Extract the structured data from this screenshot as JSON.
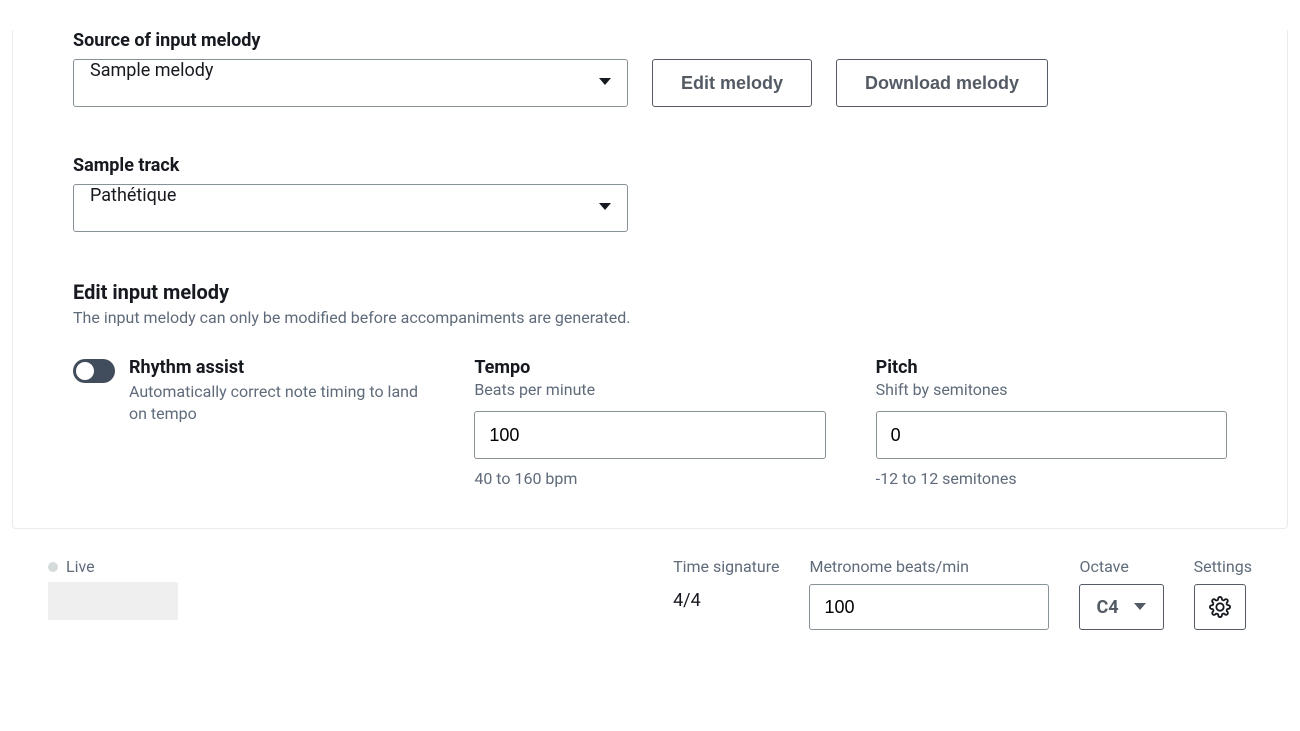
{
  "source": {
    "label": "Source of input melody",
    "value": "Sample melody",
    "edit_btn": "Edit melody",
    "download_btn": "Download melody"
  },
  "sample_track": {
    "label": "Sample track",
    "value": "Pathétique"
  },
  "edit_section": {
    "title": "Edit input melody",
    "desc": "The input melody can only be modified before accompaniments are generated."
  },
  "rhythm": {
    "label": "Rhythm assist",
    "desc": "Automatically correct note timing to land on tempo"
  },
  "tempo": {
    "label": "Tempo",
    "sub": "Beats per minute",
    "value": "100",
    "hint": "40 to 160 bpm"
  },
  "pitch": {
    "label": "Pitch",
    "sub": "Shift by semitones",
    "value": "0",
    "hint": "-12 to 12 semitones"
  },
  "footer": {
    "live": "Live",
    "time_sig_label": "Time signature",
    "time_sig_value": "4/4",
    "metronome_label": "Metronome beats/min",
    "metronome_value": "100",
    "octave_label": "Octave",
    "octave_value": "C4",
    "settings_label": "Settings"
  }
}
